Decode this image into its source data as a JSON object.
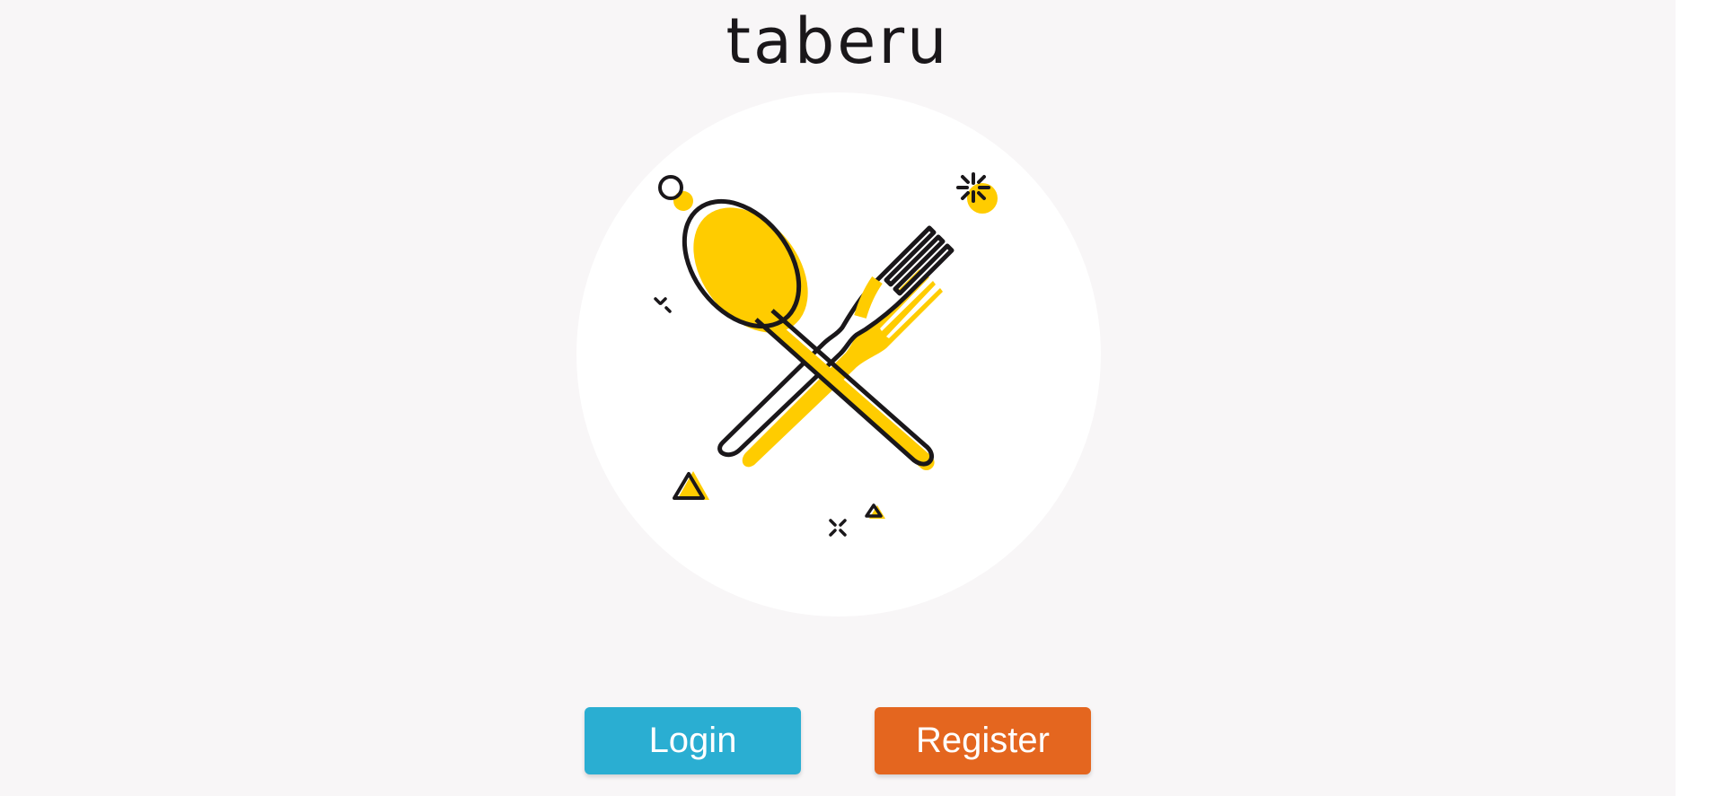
{
  "brand": {
    "name": "taberu"
  },
  "hero": {
    "icon": "spoon-and-fork-icon",
    "accent_color": "#ffcc00",
    "outline_color": "#1a171a"
  },
  "actions": {
    "login_label": "Login",
    "register_label": "Register",
    "login_color": "#2aaed2",
    "register_color": "#e4661f"
  }
}
